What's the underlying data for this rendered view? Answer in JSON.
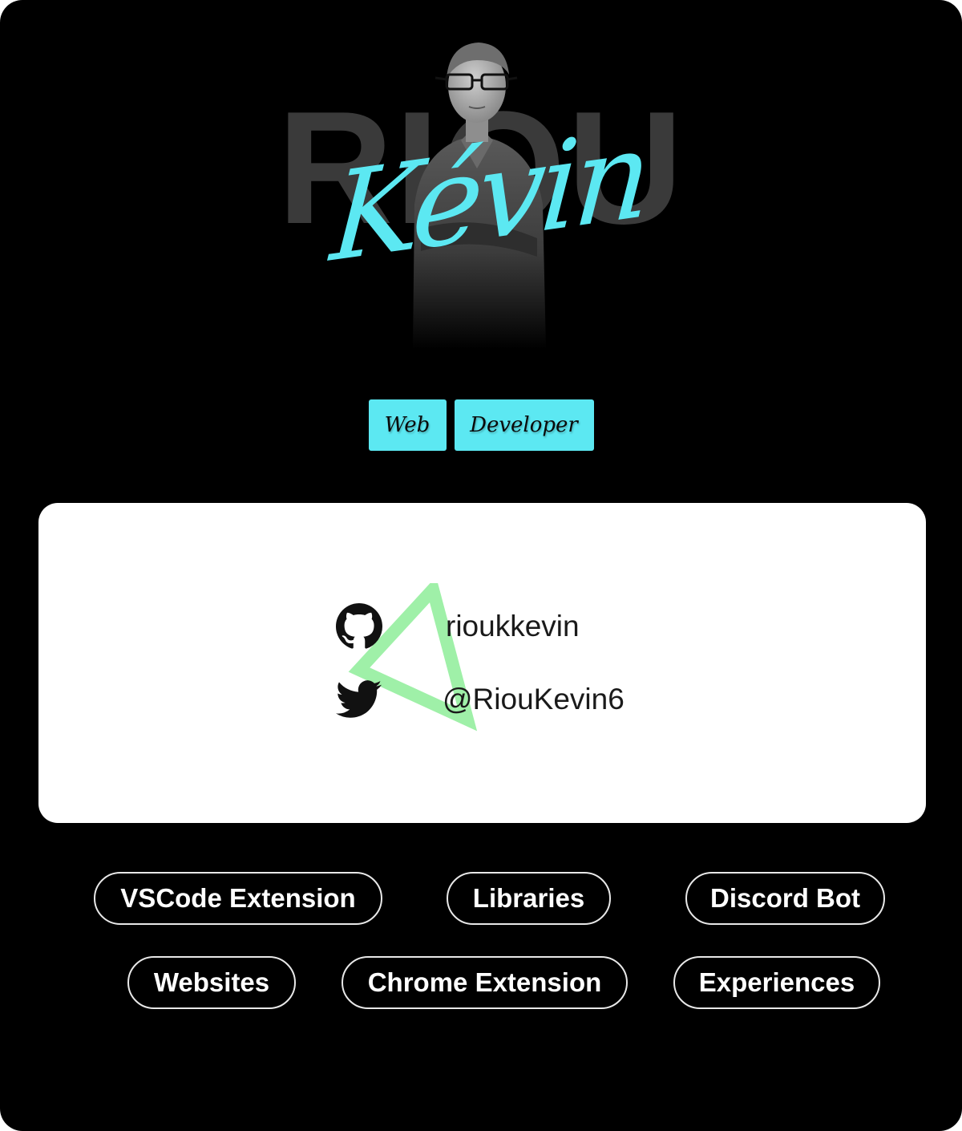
{
  "hero": {
    "surname": "RIOU",
    "firstname": "Kévin"
  },
  "title": {
    "words": [
      "Web",
      "Developer"
    ]
  },
  "social": {
    "github": {
      "icon": "github-icon",
      "handle": "rioukkevin"
    },
    "twitter": {
      "icon": "twitter-icon",
      "handle": "@RiouKevin6"
    }
  },
  "categories": [
    "VSCode Extension",
    "Libraries",
    "Discord Bot",
    "Websites",
    "Chrome Extension",
    "Experiences"
  ],
  "colors": {
    "background": "#000000",
    "accent": "#5ce8f2",
    "surname": "#3a3a3a",
    "triangle": "#9ff0a8",
    "card": "#ffffff"
  }
}
